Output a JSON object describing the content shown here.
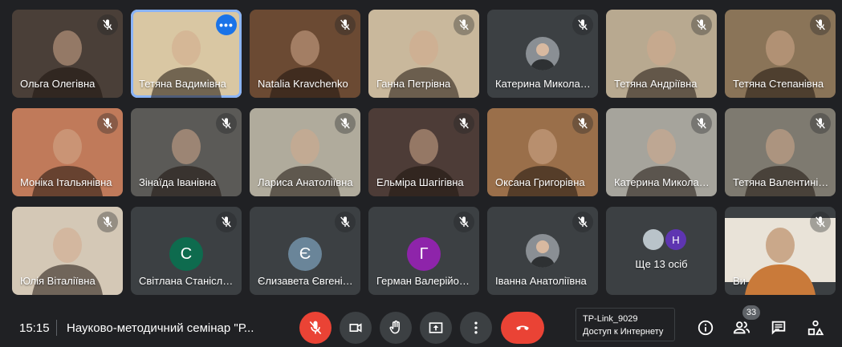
{
  "tiles": [
    {
      "name": "Ольга Олегівна",
      "bg": "#4a3f38",
      "muted": true
    },
    {
      "name": "Тетяна Вадимівна",
      "bg": "#d9c7a3",
      "muted": false,
      "active": true
    },
    {
      "name": "Natalia Kravchenko",
      "bg": "#6b4a33",
      "muted": true
    },
    {
      "name": "Ганна Петрівна",
      "bg": "#c9b89c",
      "muted": true
    },
    {
      "name": "Катерина Миколаївна",
      "bg": "#3c4043",
      "muted": true,
      "avatar": true
    },
    {
      "name": "Тетяна Андріївна",
      "bg": "#b8a990",
      "muted": true
    },
    {
      "name": "Тетяна Степанівна",
      "bg": "#8a7458",
      "muted": true
    },
    {
      "name": "Моніка Італьянівна",
      "bg": "#c07a5a",
      "muted": true
    },
    {
      "name": "Зінаїда Іванівна",
      "bg": "#5b5a57",
      "muted": true
    },
    {
      "name": "Лариса Анатоліївна",
      "bg": "#b0ab9c",
      "muted": true
    },
    {
      "name": "Ельміра Шагігівна",
      "bg": "#4d3c37",
      "muted": true
    },
    {
      "name": "Оксана Григорівна",
      "bg": "#9a6f4a",
      "muted": true
    },
    {
      "name": "Катерина Миколаївна",
      "bg": "#a6a49c",
      "muted": true
    },
    {
      "name": "Тетяна Валентинівна",
      "bg": "#7e7a70",
      "muted": true
    },
    {
      "name": "Юлія Віталіївна",
      "bg": "#d4c8b6",
      "muted": true
    },
    {
      "name": "Світлана Станіславівна",
      "bg": "#3c4043",
      "muted": true,
      "initial": "С",
      "color": "#0e6b4e"
    },
    {
      "name": "Єлизавета Євгенівна",
      "bg": "#3c4043",
      "muted": true,
      "initial": "Є",
      "color": "#6a8599"
    },
    {
      "name": "Герман Валерійович",
      "bg": "#3c4043",
      "muted": true,
      "initial": "Г",
      "color": "#8e24aa"
    },
    {
      "name": "Іванна Анатоліївна",
      "bg": "#3c4043",
      "muted": true,
      "avatar": true
    },
    {
      "name": "Ще 13 осіб",
      "bg": "#3c4043",
      "muted": false,
      "others": true,
      "mini_initial": "Н"
    },
    {
      "name": "Ви",
      "bg": "#3c4043",
      "muted": true,
      "self": true
    }
  ],
  "bottom": {
    "time": "15:15",
    "title": "Науково-методичний семінар \"Р...",
    "participants_count": "33",
    "tooltip_line1": "TP-Link_9029",
    "tooltip_line2": "Доступ к Интернету"
  }
}
